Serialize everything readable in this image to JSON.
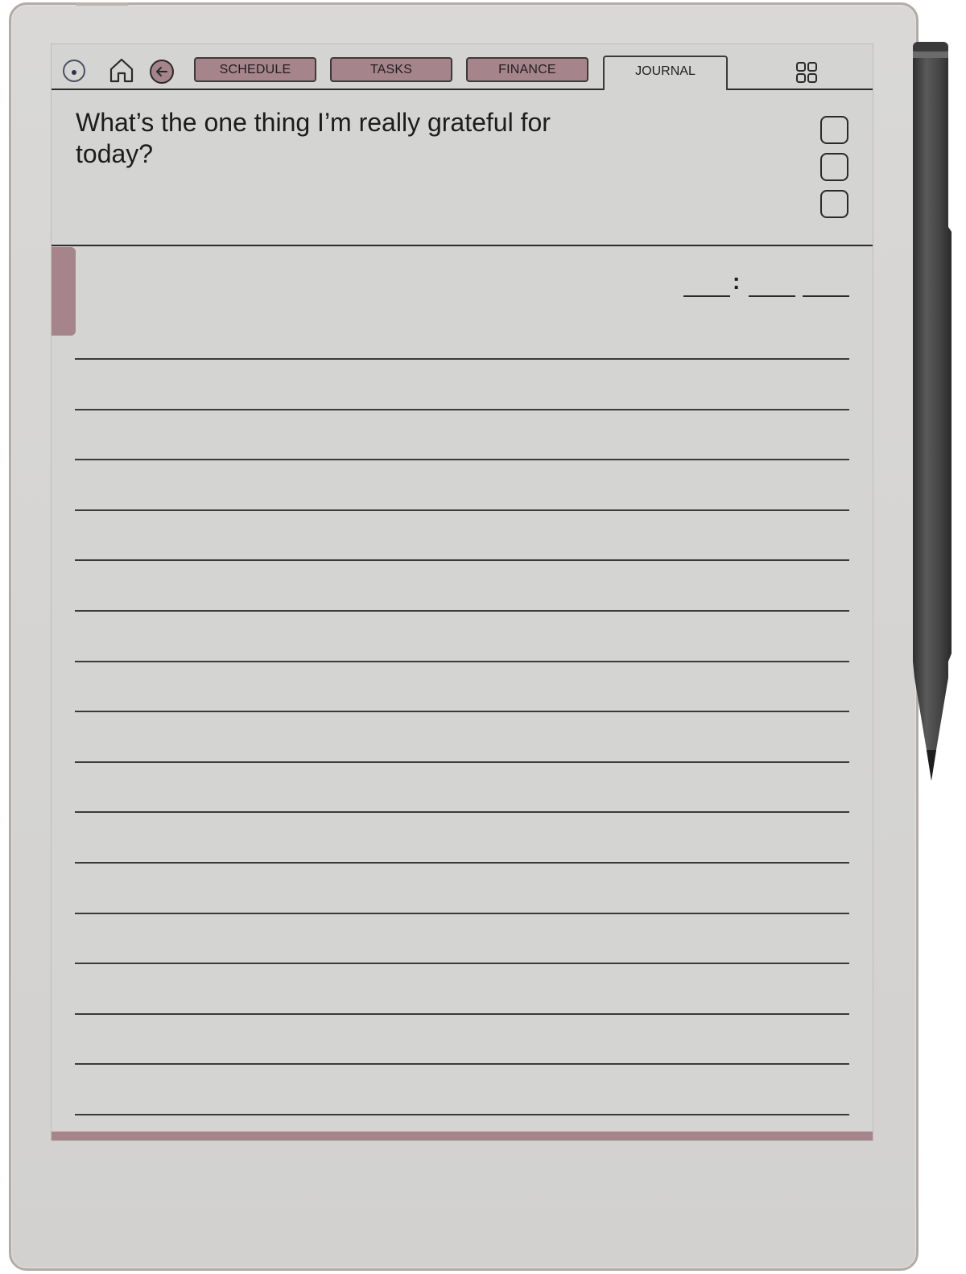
{
  "toolbar": {
    "icons": {
      "record": "record-icon",
      "home": "home-icon",
      "back": "back-arrow-icon",
      "grid": "grid-icon"
    },
    "tabs": [
      {
        "label": "SCHEDULE",
        "active": false
      },
      {
        "label": "TASKS",
        "active": false
      },
      {
        "label": "FINANCE",
        "active": false
      },
      {
        "label": "JOURNAL",
        "active": true
      }
    ]
  },
  "journal": {
    "prompt": "What’s the one thing I’m really grateful for today?",
    "checkbox_count": 3,
    "time_separator": ":",
    "ruled_line_count": 16
  },
  "colors": {
    "accent": "#a6848c",
    "screen": "#d4d4d3",
    "ink": "#2b2b2b",
    "device_frame": "#b3aba6",
    "stylus": "#4a4a4a"
  }
}
